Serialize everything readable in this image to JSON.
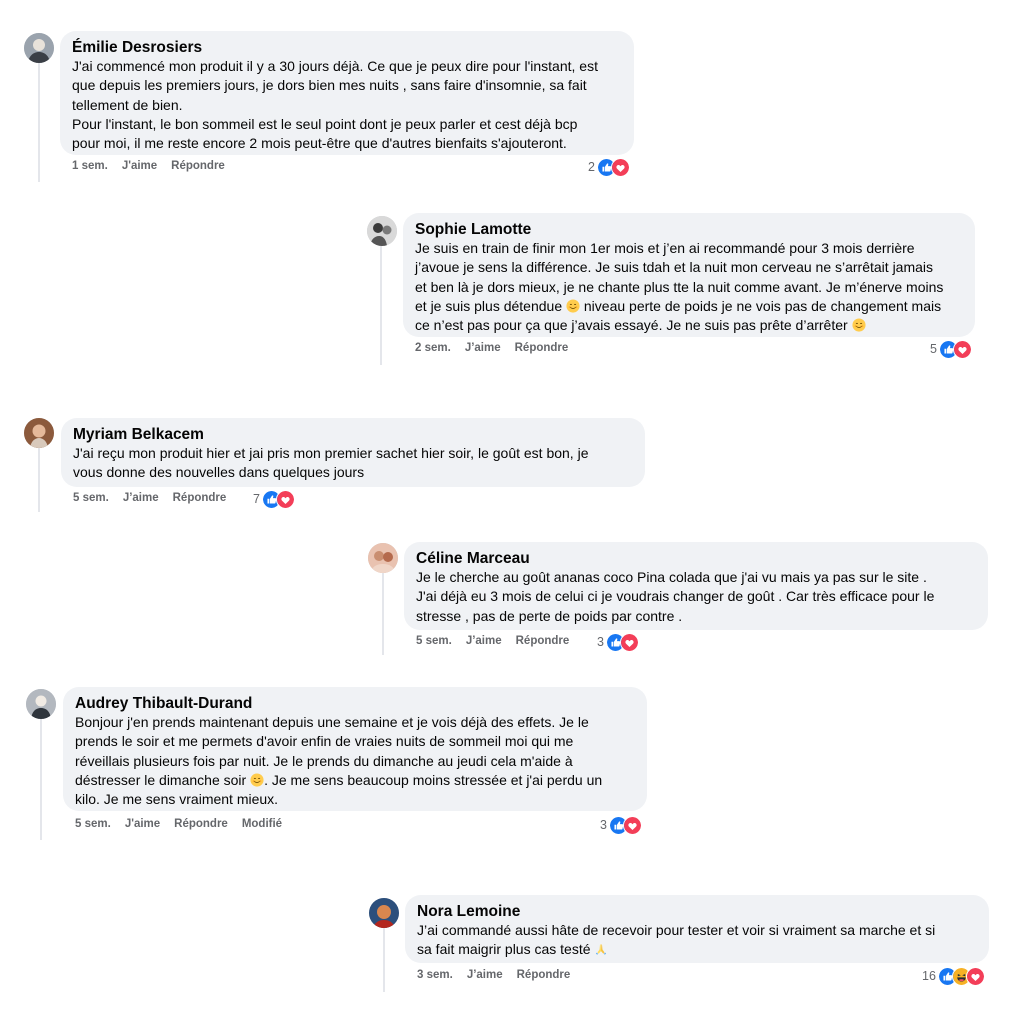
{
  "comments": [
    {
      "author": "Émilie Desrosiers",
      "lines": [
        "J'ai commencé mon produit il y a 30 jours déjà. Ce que je peux dire pour l'instant, est",
        "que depuis les premiers jours, je dors bien mes nuits , sans faire d'insomnie, sa fait",
        "tellement de bien.",
        "Pour l'instant, le bon sommeil est le seul point dont je peux parler et cest déjà bcp",
        "pour moi, il me reste encore 2 mois peut-être que d'autres bienfaits s'ajouteront."
      ],
      "time": "1 sem.",
      "like": "J'aime",
      "reply": "Répondre",
      "reaction_count": "2",
      "reactions": [
        "like-icon",
        "love-icon"
      ]
    },
    {
      "author": "Sophie Lamotte",
      "lines": [
        "Je suis en train de finir mon 1er mois et j’en ai recommandé pour 3 mois derrière",
        "j’avoue je sens la différence. Je suis tdah et la nuit mon cerveau ne s’arrêtait jamais",
        "et ben là je dors mieux, je ne chante plus tte la nuit comme avant. Je m’énerve moins",
        "et je suis plus détendue",
        " niveau perte de poids je ne vois pas de changement mais",
        "ce n’est pas pour ça que j’avais essayé. Je ne suis pas prête d’arrêter"
      ],
      "time": "2 sem.",
      "like": "J’aime",
      "reply": "Répondre",
      "reaction_count": "5",
      "reactions": [
        "like-icon",
        "love-icon"
      ]
    },
    {
      "author": "Myriam Belkacem",
      "lines": [
        "J'ai reçu mon produit hier et jai pris mon premier sachet hier soir, le goût est bon, je",
        "vous donne des nouvelles dans quelques jours"
      ],
      "time": "5 sem.",
      "like": "J’aime",
      "reply": "Répondre",
      "reaction_count": "7",
      "reactions": [
        "like-icon",
        "love-icon"
      ]
    },
    {
      "author": "Céline Marceau",
      "lines": [
        "Je le cherche au goût ananas coco Pina colada que j'ai vu mais ya pas sur le site .",
        "J'ai déjà eu 3 mois de celui ci je voudrais changer de goût . Car très efficace pour le",
        "stresse , pas de perte de poids par contre ."
      ],
      "time": "5 sem.",
      "like": "J’aime",
      "reply": "Répondre",
      "reaction_count": "3",
      "reactions": [
        "like-icon",
        "love-icon"
      ]
    },
    {
      "author": "Audrey Thibault-Durand",
      "lines": [
        "Bonjour j'en prends maintenant depuis une semaine et je vois déjà des effets. Je le",
        "prends le soir et me permets d'avoir enfin de vraies nuits de sommeil moi qui me",
        "réveillais plusieurs fois par nuit. Je le prends du dimanche au jeudi cela m'aide à",
        "déstresser le dimanche soir",
        ". Je me sens beaucoup moins stressée et j'ai perdu un",
        "kilo. Je me sens vraiment mieux."
      ],
      "time": "5 sem.",
      "like": "J'aime",
      "reply": "Répondre",
      "modified": "Modifié",
      "reaction_count": "3",
      "reactions": [
        "like-icon",
        "love-icon"
      ]
    },
    {
      "author": "Nora Lemoine",
      "lines": [
        "J’ai commandé aussi hâte de recevoir pour tester et voir si vraiment sa marche et si",
        "sa fait maigrir plus cas testé"
      ],
      "time": "3 sem.",
      "like": "J’aime",
      "reply": "Répondre",
      "reaction_count": "16",
      "reactions": [
        "like-icon",
        "haha-icon",
        "love-icon"
      ]
    }
  ],
  "colors": {
    "bubble": "#f0f2f5",
    "like": "#1877f2",
    "love": "#f33e58",
    "haha": "#f7b125",
    "meta_text": "#65676b"
  }
}
